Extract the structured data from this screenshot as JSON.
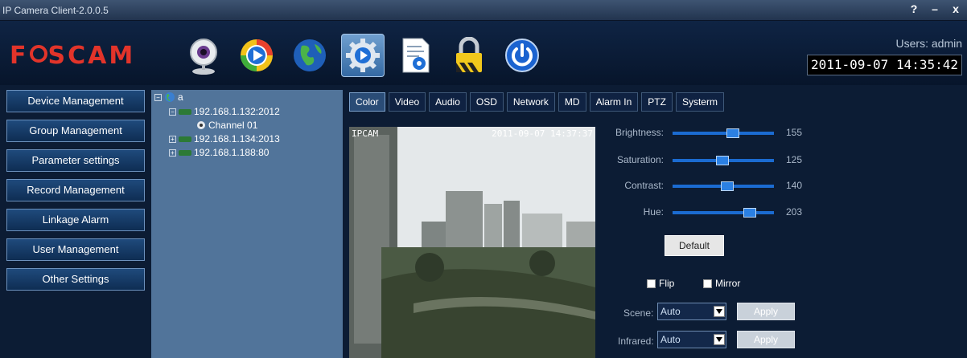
{
  "window": {
    "title": "IP Camera Client-2.0.0.5",
    "help": "?",
    "minimize": "–",
    "close": "x"
  },
  "brand": {
    "logo_pre": "F",
    "logo_post": "SCAM",
    "color": "#e2342a"
  },
  "toolbar": [
    {
      "icon": "webcam-icon"
    },
    {
      "icon": "play-icon"
    },
    {
      "icon": "globe-icon"
    },
    {
      "icon": "settings-gear-icon",
      "active": true
    },
    {
      "icon": "document-icon"
    },
    {
      "icon": "lock-icon"
    },
    {
      "icon": "power-icon"
    }
  ],
  "header": {
    "users": "Users: admin",
    "datetime": "2011-09-07 14:35:42"
  },
  "nav": [
    "Device Management",
    "Group Management",
    "Parameter settings",
    "Record Management",
    "Linkage Alarm",
    "User Management",
    "Other Settings"
  ],
  "tree": {
    "root": "a",
    "devices": [
      {
        "label": "192.168.1.132:2012",
        "expanded": true,
        "channel": "Channel 01"
      },
      {
        "label": "192.168.1.134:2013",
        "expanded": false
      },
      {
        "label": "192.168.1.188:80",
        "expanded": false
      }
    ]
  },
  "tabs": [
    "Color",
    "Video",
    "Audio",
    "OSD",
    "Network",
    "MD",
    "Alarm In",
    "PTZ",
    "Systerm"
  ],
  "active_tab": "Color",
  "video": {
    "osd_name": "IPCAM",
    "osd_time": "2011-09-07 14:37:37"
  },
  "sliders": [
    {
      "label": "Brightness:",
      "value": "155",
      "level": 155
    },
    {
      "label": "Saturation:",
      "value": "125",
      "level": 125
    },
    {
      "label": "Contrast:",
      "value": "140",
      "level": 140
    },
    {
      "label": "Hue:",
      "value": "203",
      "level": 203
    }
  ],
  "slider_max": 255,
  "default_button": "Default",
  "checks": {
    "flip": "Flip",
    "mirror": "Mirror"
  },
  "scene": {
    "label": "Scene:",
    "value": "Auto",
    "apply": "Apply"
  },
  "infrared": {
    "label": "Infrared:",
    "value": "Auto",
    "apply": "Apply"
  }
}
